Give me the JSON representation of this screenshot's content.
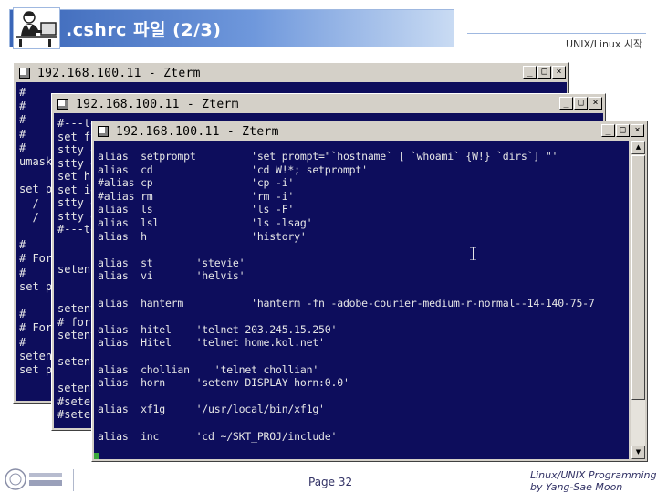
{
  "slide": {
    "title": ".cshrc 파일 (2/3)",
    "section": "UNIX/Linux 시작",
    "page_label": "Page 32",
    "credit_line1": "Linux/UNIX Programming",
    "credit_line2": "by Yang-Sae Moon"
  },
  "windows": [
    {
      "title": "192.168.100.11 - Zterm",
      "buttons": [
        "_",
        "□",
        "×"
      ],
      "lines": [
        "#",
        "#",
        "#",
        "#",
        "#",
        "umask",
        "",
        "set p",
        "  /",
        "  /",
        "",
        "#",
        "# For",
        "#",
        "set p",
        "",
        "#",
        "# For",
        "#",
        "seten",
        "set p"
      ]
    },
    {
      "title": "192.168.100.11 - Zterm",
      "buttons": [
        "_",
        "□",
        "×"
      ],
      "lines": [
        "#---te",
        "set ft",
        "stty e",
        "stty e",
        "set hi",
        "set ig",
        "stty e",
        "stty e",
        "#---te",
        "",
        "",
        "setenv",
        "",
        "",
        "setenv",
        "# for",
        "setenv",
        "",
        "setenv",
        "",
        "setenv",
        "#seten",
        "#seten"
      ]
    },
    {
      "title": "192.168.100.11 - Zterm",
      "buttons": [
        "_",
        "□",
        "×"
      ],
      "lines": [
        "alias  setprompt         'set prompt=\"`hostname` [ `whoami` {W!} `dirs`] \"'",
        "alias  cd                'cd W!*; setprompt'",
        "#alias cp                'cp -i'",
        "#alias rm                'rm -i'",
        "alias  ls                'ls -F'",
        "alias  lsl               'ls -lsag'",
        "alias  h                 'history'",
        "",
        "alias  st       'stevie'",
        "alias  vi       'helvis'",
        "",
        "alias  hanterm           'hanterm -fn -adobe-courier-medium-r-normal--14-140-75-7",
        "",
        "alias  hitel    'telnet 203.245.15.250'",
        "alias  Hitel    'telnet home.kol.net'",
        "",
        "alias  chollian    'telnet chollian'",
        "alias  horn     'setenv DISPLAY horn:0.0'",
        "",
        "alias  xf1g     '/usr/local/bin/xf1g'",
        "",
        "alias  inc      'cd ~/SKT_PROJ/include'"
      ]
    }
  ],
  "colors": {
    "terminal_bg": "#0d0d5c",
    "terminal_fg": "#e6e6e6",
    "window_chrome": "#d4d0c8",
    "cursor": "#3aa83a",
    "header_gradient_start": "#3a66b8"
  },
  "icons": {
    "header_logo": "person-at-computer-icon",
    "footer_logo": "university-seal-icon"
  }
}
